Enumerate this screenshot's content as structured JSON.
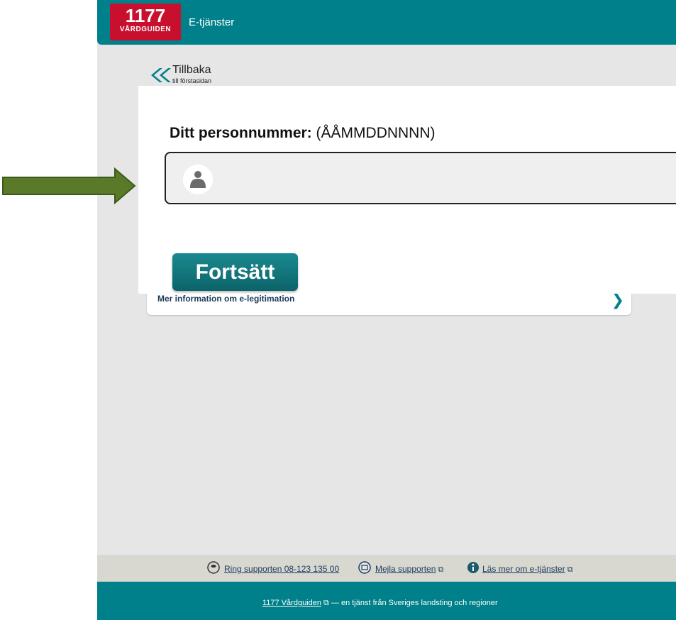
{
  "header": {
    "logo_number": "1177",
    "logo_name": "VÅRDGUIDEN",
    "title": "E-tjänster"
  },
  "back": {
    "label": "Tillbaka",
    "sub": "till förstasidan"
  },
  "form": {
    "label_bold": "Ditt personnummer:",
    "label_hint": "(ÅÅMMDDNNNN)",
    "input_value": "",
    "continue_label": "Fortsätt"
  },
  "info": {
    "text": "Mer information om e-legitimation"
  },
  "support": {
    "phone": "Ring supporten 08-123 135 00",
    "email": "Mejla supporten",
    "read_more": "Läs mer om e-tjänster"
  },
  "footer": {
    "link": "1177 Vårdguiden",
    "text": "— en tjänst från Sveriges landsting och regioner"
  },
  "colors": {
    "brand_teal": "#00808a",
    "logo_red": "#c8102e",
    "arrow_green": "#5a7a2a"
  }
}
